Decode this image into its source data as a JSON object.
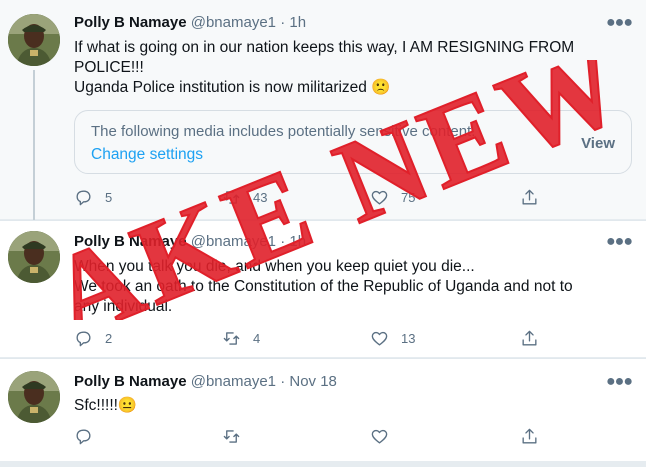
{
  "tweets": [
    {
      "name": "Polly B Namaye",
      "handle": "@bnamaye1",
      "sep": "·",
      "time": "1h",
      "text_line1": "If what is going on in our nation keeps this way, I AM RESIGNING FROM",
      "text_line2": "POLICE!!!",
      "text_line3": "Uganda Police institution is now militarized 🙁",
      "media_warning": {
        "text": "The following media includes potentially sensitive content.",
        "link": "Change settings",
        "view": "View"
      },
      "replies": "5",
      "retweets": "43",
      "likes": "75"
    },
    {
      "name": "Polly B Namaye",
      "handle": "@bnamaye1",
      "sep": "·",
      "time": "1h",
      "text_line1": "When you talk you die, and when you keep quiet you die...",
      "text_line2": "We took an oath to the Constitution of the Republic of Uganda and not to",
      "text_line3": "any individual.",
      "replies": "2",
      "retweets": "4",
      "likes": "13"
    },
    {
      "name": "Polly B Namaye",
      "handle": "@bnamaye1",
      "sep": "·",
      "time": "Nov 18",
      "text_line1": "Sfc!!!!!😐",
      "replies": "",
      "retweets": "",
      "likes": ""
    }
  ],
  "stamp": {
    "text": "FAKE NEWS",
    "color": "#e0202a"
  },
  "icons": [
    "reply-icon",
    "retweet-icon",
    "like-icon",
    "share-icon",
    "more-icon"
  ]
}
